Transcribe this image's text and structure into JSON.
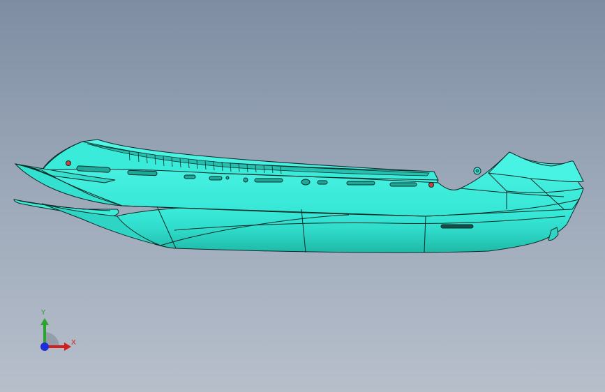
{
  "viewport": {
    "background_top": "#7e8da2",
    "background_bottom": "#b7bfcb"
  },
  "model": {
    "part": "side-cowl-panel",
    "face_color": "#3cf0df",
    "face_shade_color": "#27c9b6",
    "edge_color": "#0b2a26",
    "hole_color": "#d04040"
  },
  "triad": {
    "x_label": "X",
    "y_label": "Y",
    "x_color": "#d02020",
    "y_color": "#2fa32f",
    "z_color": "#1f2fd8"
  }
}
